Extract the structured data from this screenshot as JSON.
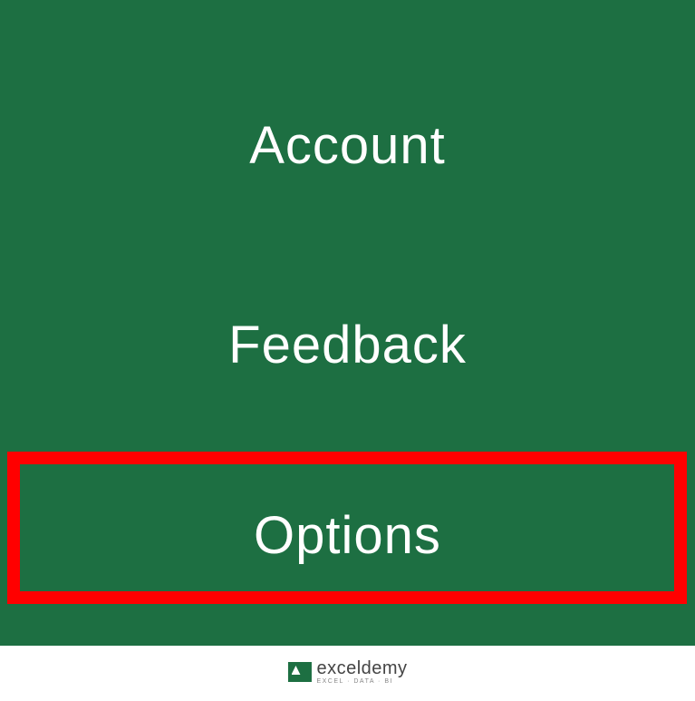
{
  "menu": {
    "items": [
      {
        "label": "Account"
      },
      {
        "label": "Feedback"
      },
      {
        "label": "Options"
      }
    ]
  },
  "highlight": {
    "target": "options"
  },
  "watermark": {
    "main": "exceldemy",
    "sub": "EXCEL · DATA · BI"
  }
}
